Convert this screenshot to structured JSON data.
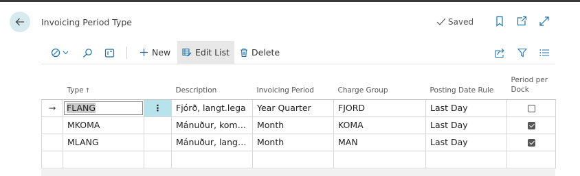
{
  "header": {
    "title": "Invoicing Period Type",
    "saved_label": "Saved"
  },
  "actionbar": {
    "new_label": "New",
    "edit_list_label": "Edit List",
    "delete_label": "Delete"
  },
  "table": {
    "columns": {
      "type": "Type",
      "description": "Description",
      "invoicing_period": "Invoicing Period",
      "charge_group": "Charge Group",
      "posting_date_rule": "Posting Date Rule",
      "period_per_dock_line1": "Period per",
      "period_per_dock_line2": "Dock"
    },
    "sort_indicator": "↑",
    "rows": [
      {
        "type": "FLANG",
        "description": "Fjórð, langt.lega",
        "invoicing_period": "Year Quarter",
        "charge_group": "FJORD",
        "posting_date_rule": "Last Day",
        "period_per_dock": false
      },
      {
        "type": "MKOMA",
        "description": "Mánuður, komub...",
        "invoicing_period": "Month",
        "charge_group": "KOMA",
        "posting_date_rule": "Last Day",
        "period_per_dock": true
      },
      {
        "type": "MLANG",
        "description": "Mánuður, langt.le...",
        "invoicing_period": "Month",
        "charge_group": "MAN",
        "posting_date_rule": "Last Day",
        "period_per_dock": true
      }
    ],
    "row_menu_glyph": "⋮",
    "current_row_glyph": "→"
  },
  "colors": {
    "accent": "#1e6fa8",
    "back_button_bg": "#d6eaef",
    "active_cell_bg": "#b8e3ec"
  }
}
